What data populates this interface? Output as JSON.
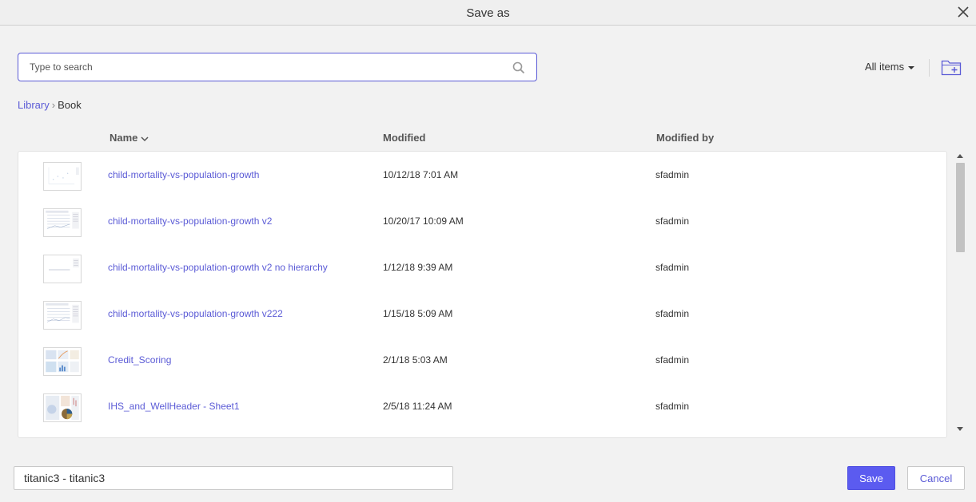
{
  "window": {
    "title": "Save as"
  },
  "search": {
    "placeholder": "Type to search",
    "value": ""
  },
  "filter": {
    "label": "All items"
  },
  "breadcrumb": {
    "items": [
      "Library",
      "Book"
    ]
  },
  "columns": {
    "name": "Name",
    "modified": "Modified",
    "modified_by": "Modified by"
  },
  "rows": [
    {
      "name": "child-mortality-vs-population-growth",
      "modified": "10/12/18 7:01 AM",
      "modified_by": "sfadmin"
    },
    {
      "name": "child-mortality-vs-population-growth v2",
      "modified": "10/20/17 10:09 AM",
      "modified_by": "sfadmin"
    },
    {
      "name": "child-mortality-vs-population-growth v2 no hierarchy",
      "modified": "1/12/18 9:39 AM",
      "modified_by": "sfadmin"
    },
    {
      "name": "child-mortality-vs-population-growth v222",
      "modified": "1/15/18 5:09 AM",
      "modified_by": "sfadmin"
    },
    {
      "name": "Credit_Scoring",
      "modified": "2/1/18 5:03 AM",
      "modified_by": "sfadmin"
    },
    {
      "name": "IHS_and_WellHeader - Sheet1",
      "modified": "2/5/18 11:24 AM",
      "modified_by": "sfadmin"
    }
  ],
  "footer": {
    "filename": "titanic3 - titanic3",
    "save_label": "Save",
    "cancel_label": "Cancel"
  },
  "colors": {
    "accent": "#5b5bd6",
    "save_button": "#5b5bf0"
  },
  "icons": {
    "close": "close-icon",
    "search": "search-icon",
    "new_folder": "new-folder-icon",
    "sort": "chevron-down-icon"
  }
}
